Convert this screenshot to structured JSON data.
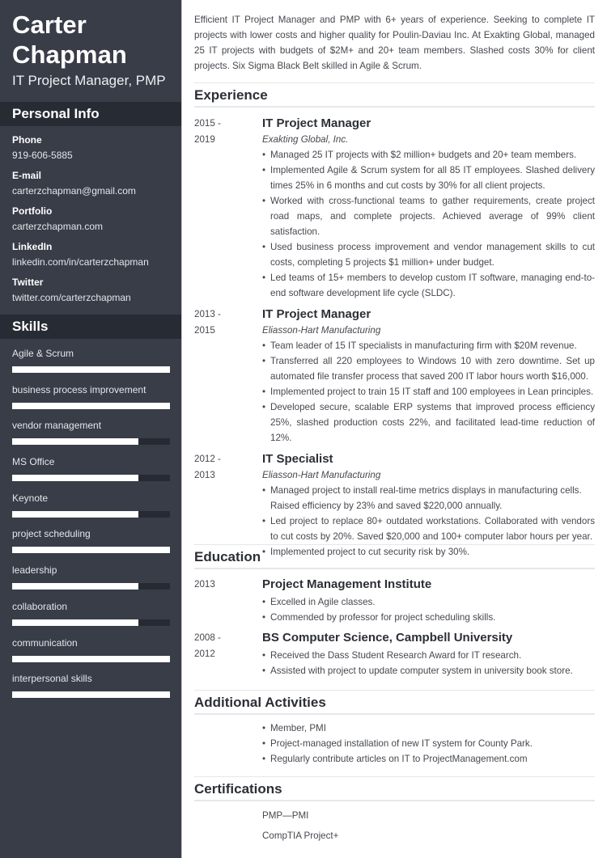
{
  "sidebar": {
    "name_first": "Carter",
    "name_last": "Chapman",
    "title": "IT Project Manager, PMP",
    "personal_info": {
      "heading": "Personal Info",
      "items": [
        {
          "label": "Phone",
          "value": "919-606-5885"
        },
        {
          "label": "E-mail",
          "value": "carterzchapman@gmail.com"
        },
        {
          "label": "Portfolio",
          "value": "carterzchapman.com"
        },
        {
          "label": "LinkedIn",
          "value": "linkedin.com/in/carterzchapman"
        },
        {
          "label": "Twitter",
          "value": "twitter.com/carterzchapman"
        }
      ]
    },
    "skills": {
      "heading": "Skills",
      "items": [
        {
          "label": "Agile & Scrum",
          "level": 1.0
        },
        {
          "label": "business process improvement",
          "level": 1.0
        },
        {
          "label": "vendor management",
          "level": 0.8
        },
        {
          "label": "MS Office",
          "level": 0.8
        },
        {
          "label": "Keynote",
          "level": 0.8
        },
        {
          "label": "project scheduling",
          "level": 1.0
        },
        {
          "label": "leadership",
          "level": 0.8
        },
        {
          "label": "collaboration",
          "level": 0.8
        },
        {
          "label": "communication",
          "level": 1.0
        },
        {
          "label": "interpersonal skills",
          "level": 1.0
        }
      ]
    }
  },
  "main": {
    "summary": "Efficient IT Project Manager and PMP with 6+ years of experience. Seeking to complete IT projects with lower costs and higher quality for Poulin-Daviau Inc. At Exakting Global, managed 25 IT projects with budgets of $2M+ and 20+ team members. Slashed costs 30% for client projects. Six Sigma Black Belt skilled in Agile & Scrum.",
    "experience": {
      "heading": "Experience",
      "entries": [
        {
          "date_start": "2015 -",
          "date_end": "2019",
          "title": "IT Project Manager",
          "company": "Exakting Global, Inc.",
          "bullets": [
            "Managed 25 IT projects with $2 million+ budgets and 20+ team members.",
            "Implemented Agile & Scrum system for all 85 IT employees. Slashed delivery times 25% in 6 months and cut costs by 30% for all client projects.",
            "Worked with cross-functional teams to gather requirements, create project road maps, and complete projects. Achieved average of 99% client satisfaction.",
            "Used business process improvement and vendor management skills to cut costs, completing 5 projects $1 million+ under budget.",
            "Led teams of 15+ members to develop custom IT software, managing end-to-end software development life cycle (SLDC)."
          ]
        },
        {
          "date_start": "2013 -",
          "date_end": "2015",
          "title": "IT Project Manager",
          "company": "Eliasson-Hart Manufacturing",
          "bullets": [
            "Team leader of 15 IT specialists in manufacturing firm with $20M revenue.",
            "Transferred all 220 employees to Windows 10 with zero downtime. Set up automated file transfer process that saved 200 IT labor hours worth $16,000.",
            "Implemented project to train 15 IT staff and 100 employees in Lean principles.",
            "Developed secure, scalable ERP systems that improved process efficiency 25%, slashed production costs 22%, and facilitated lead-time reduction of 12%."
          ]
        },
        {
          "date_start": "2012 -",
          "date_end": "2013",
          "title": "IT Specialist",
          "company": "Eliasson-Hart Manufacturing",
          "bullets": [
            "Managed project to install real-time metrics displays in manufacturing cells.\nRaised efficiency by 23% and saved $220,000 annually.",
            "Led project to replace 80+ outdated workstations. Collaborated with vendors to cut costs by 20%. Saved $20,000 and 100+ computer labor hours per year.",
            "Implemented project to cut security risk by 30%."
          ]
        }
      ]
    },
    "education": {
      "heading": "Education",
      "entries": [
        {
          "date_start": "2013",
          "date_end": "",
          "title": "Project Management Institute",
          "bullets": [
            "Excelled in Agile classes.",
            "Commended by professor for project scheduling skills."
          ]
        },
        {
          "date_start": "2008 -",
          "date_end": "2012",
          "title": "BS Computer Science, Campbell University",
          "bullets": [
            "Received the Dass Student Research Award for IT research.",
            "Assisted with project to update computer system in university book store."
          ]
        }
      ]
    },
    "activities": {
      "heading": "Additional Activities",
      "bullets": [
        "Member, PMI",
        "Project-managed installation of new IT system for County Park.",
        "Regularly contribute articles on IT to ProjectManagement.com"
      ]
    },
    "certifications": {
      "heading": "Certifications",
      "items": [
        "PMP—PMI",
        "CompTIA Project+"
      ]
    },
    "bullet_glyph": "•"
  }
}
